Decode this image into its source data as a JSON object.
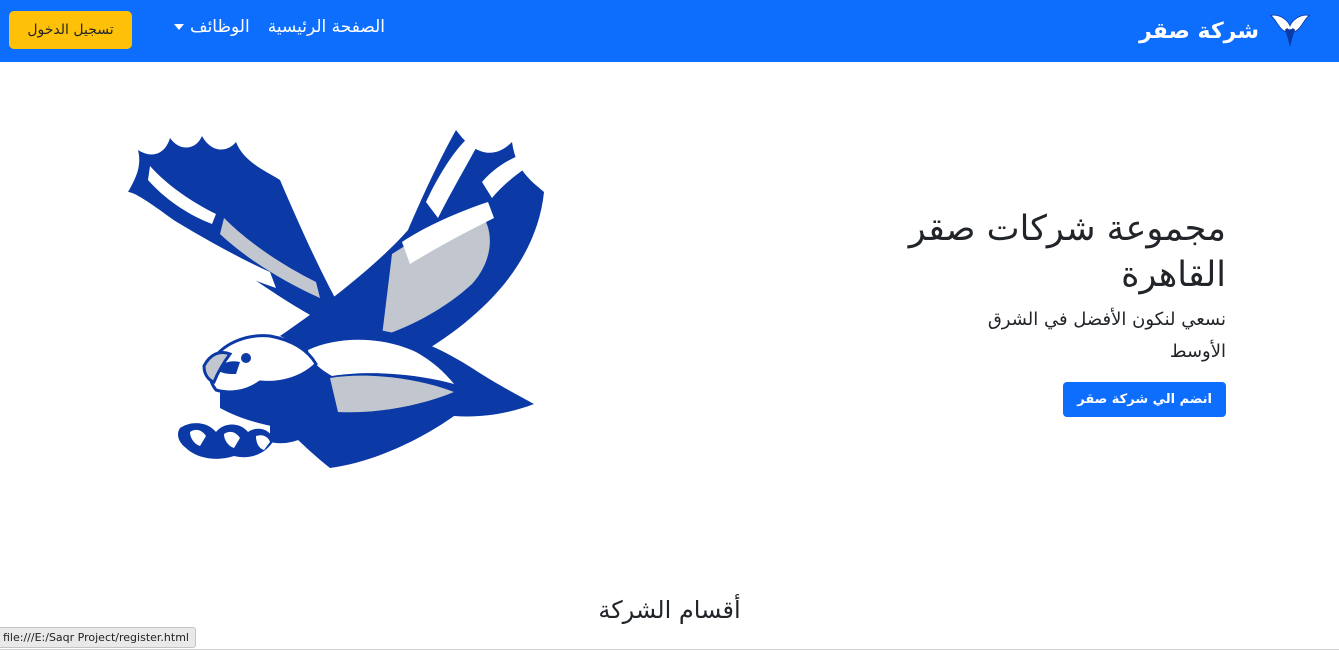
{
  "navbar": {
    "brand_name": "شركة صقر",
    "brand_logo_icon": "eagle-icon",
    "links": {
      "home": "الصفحة الرئيسية",
      "jobs": "الوظائف"
    },
    "login_label": "تسجيل الدخول",
    "colors": {
      "background": "#0d6efd",
      "login_button": "#ffc107"
    }
  },
  "hero": {
    "title": "مجموعة شركات صقر القاهرة",
    "subtitle": "نسعي لنكون الأفضل في الشرق الأوسط",
    "cta_label": "انضم الي شركة صقر",
    "image_icon": "eagle-icon",
    "colors": {
      "eagle_primary": "#0b3aa6",
      "eagle_secondary": "#c2c7cf"
    }
  },
  "section": {
    "title": "أقسام الشركة"
  },
  "status_bar": {
    "url": "file:///E:/Saqr Project/register.html"
  }
}
